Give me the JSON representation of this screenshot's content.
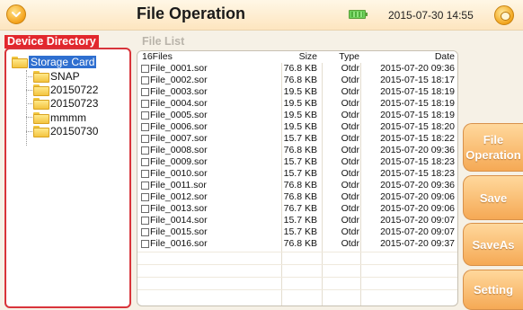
{
  "header": {
    "title": "File Operation",
    "datetime": "2015-07-30 14:55",
    "menu_icon": "chevron-down-icon",
    "battery_icon": "battery-icon",
    "status_icon": "status-icon"
  },
  "directory": {
    "label": "Device Directory",
    "root": "Storage Card",
    "folders": [
      "SNAP",
      "20150722",
      "20150723",
      "mmmm",
      "20150730"
    ]
  },
  "file_list": {
    "label": "File List",
    "columns": {
      "count": "16Files",
      "size": "Size",
      "type": "Type",
      "date": "Date"
    },
    "files": [
      {
        "name": "File_0001.sor",
        "size": "76.8 KB",
        "type": "Otdr",
        "date": "2015-07-20 09:36"
      },
      {
        "name": "File_0002.sor",
        "size": "76.8 KB",
        "type": "Otdr",
        "date": "2015-07-15 18:17"
      },
      {
        "name": "File_0003.sor",
        "size": "19.5 KB",
        "type": "Otdr",
        "date": "2015-07-15 18:19"
      },
      {
        "name": "File_0004.sor",
        "size": "19.5 KB",
        "type": "Otdr",
        "date": "2015-07-15 18:19"
      },
      {
        "name": "File_0005.sor",
        "size": "19.5 KB",
        "type": "Otdr",
        "date": "2015-07-15 18:19"
      },
      {
        "name": "File_0006.sor",
        "size": "19.5 KB",
        "type": "Otdr",
        "date": "2015-07-15 18:20"
      },
      {
        "name": "File_0007.sor",
        "size": "15.7 KB",
        "type": "Otdr",
        "date": "2015-07-15 18:22"
      },
      {
        "name": "File_0008.sor",
        "size": "76.8 KB",
        "type": "Otdr",
        "date": "2015-07-20 09:36"
      },
      {
        "name": "File_0009.sor",
        "size": "15.7 KB",
        "type": "Otdr",
        "date": "2015-07-15 18:23"
      },
      {
        "name": "File_0010.sor",
        "size": "15.7 KB",
        "type": "Otdr",
        "date": "2015-07-15 18:23"
      },
      {
        "name": "File_0011.sor",
        "size": "76.8 KB",
        "type": "Otdr",
        "date": "2015-07-20 09:36"
      },
      {
        "name": "File_0012.sor",
        "size": "76.8 KB",
        "type": "Otdr",
        "date": "2015-07-20 09:06"
      },
      {
        "name": "File_0013.sor",
        "size": "76.7 KB",
        "type": "Otdr",
        "date": "2015-07-20 09:06"
      },
      {
        "name": "File_0014.sor",
        "size": "15.7 KB",
        "type": "Otdr",
        "date": "2015-07-20 09:07"
      },
      {
        "name": "File_0015.sor",
        "size": "15.7 KB",
        "type": "Otdr",
        "date": "2015-07-20 09:07"
      },
      {
        "name": "File_0016.sor",
        "size": "76.8 KB",
        "type": "Otdr",
        "date": "2015-07-20 09:37"
      }
    ]
  },
  "side_buttons": [
    {
      "label": "File\nOperation"
    },
    {
      "label": "Save"
    },
    {
      "label": "SaveAs"
    },
    {
      "label": "Setting"
    }
  ],
  "colors": {
    "accent_red": "#e2272d",
    "button_orange": "#f5a955",
    "selection_blue": "#2f6fd0"
  }
}
